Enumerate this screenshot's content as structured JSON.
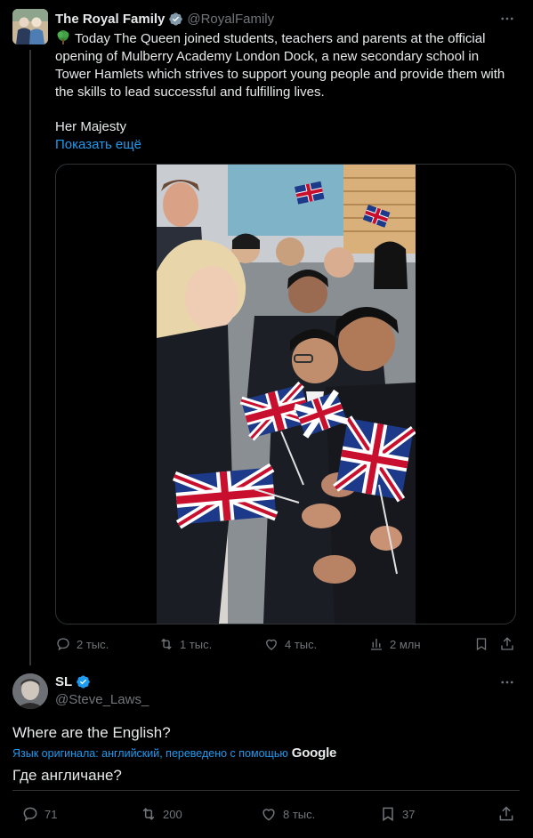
{
  "colors": {
    "accent": "#1d9bf0",
    "muted": "#71767b",
    "text": "#e7e9ea",
    "background": "#000000",
    "gold_verified": "#829aab"
  },
  "tweet": {
    "author_name": "The Royal Family",
    "author_handle": "@RoyalFamily",
    "text": "Today The Queen joined students, teachers and parents at the official opening of Mulberry Academy London Dock, a new secondary school in Tower Hamlets which strives to support young people and provide them with the skills to lead successful and fulfilling lives.",
    "text_line2": "Her Majesty",
    "show_more": "Показать ещё",
    "stats": {
      "replies": "2 тыс.",
      "retweets": "1 тыс.",
      "likes": "4 тыс.",
      "views": "2 млн"
    },
    "icons": [
      "tree-icon",
      "reply-icon",
      "retweet-icon",
      "like-icon",
      "views-icon",
      "bookmark-icon",
      "share-icon",
      "more-icon"
    ]
  },
  "reply": {
    "author_name": "SL",
    "author_handle": "@Steve_Laws_",
    "text": "Where are the English?",
    "translation_note": "Язык оригинала: английский, переведено с помощью",
    "translation_provider": "Google",
    "translated_text": "Где англичане?",
    "stats": {
      "replies": "71",
      "retweets": "200",
      "likes": "8 тыс.",
      "bookmarks": "37"
    }
  }
}
